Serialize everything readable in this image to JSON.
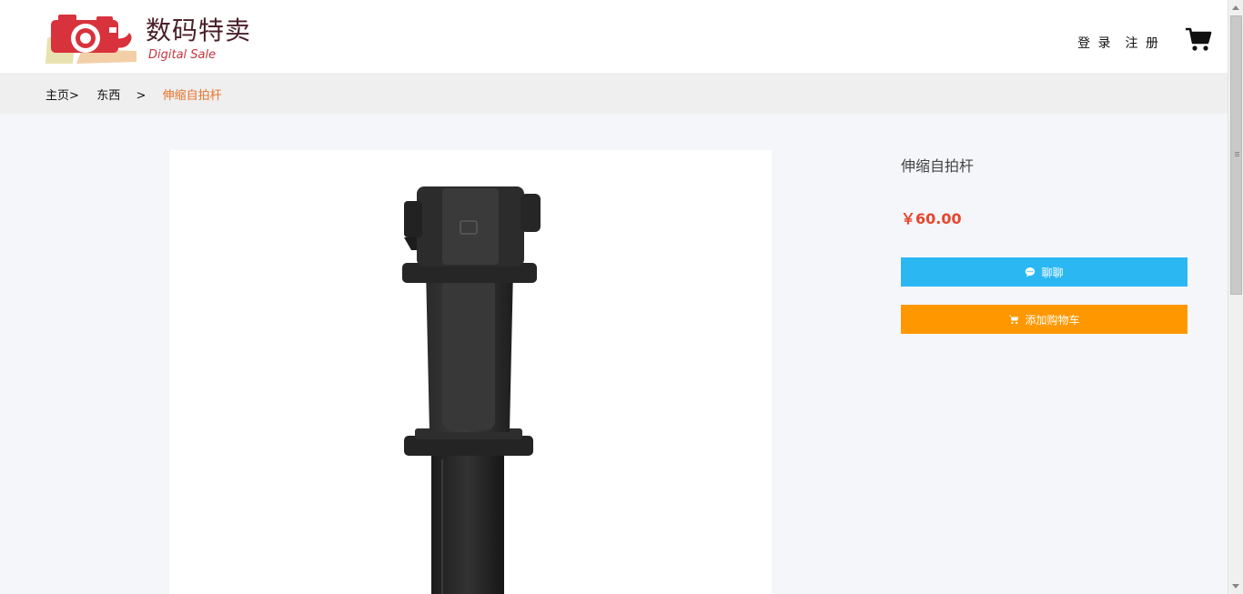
{
  "header": {
    "logo_title": "数码特卖",
    "logo_subtitle": "Digital Sale",
    "login_label": "登 录",
    "register_label": "注 册"
  },
  "breadcrumb": {
    "home": "主页>",
    "category": "东西",
    "separator": ">",
    "current": "伸缩自拍杆"
  },
  "product": {
    "name": "伸缩自拍杆",
    "price": "￥60.00"
  },
  "actions": {
    "chat_label": "聊聊",
    "add_to_cart_label": "添加购物车"
  },
  "icons": {
    "cart": "cart-icon",
    "chat": "chat-bubble-icon",
    "add_cart": "cart-small-icon"
  },
  "colors": {
    "chat_button": "#2bb8f2",
    "cart_button": "#ff9800",
    "price": "#e8452c",
    "breadcrumb_current": "#e8732a"
  }
}
